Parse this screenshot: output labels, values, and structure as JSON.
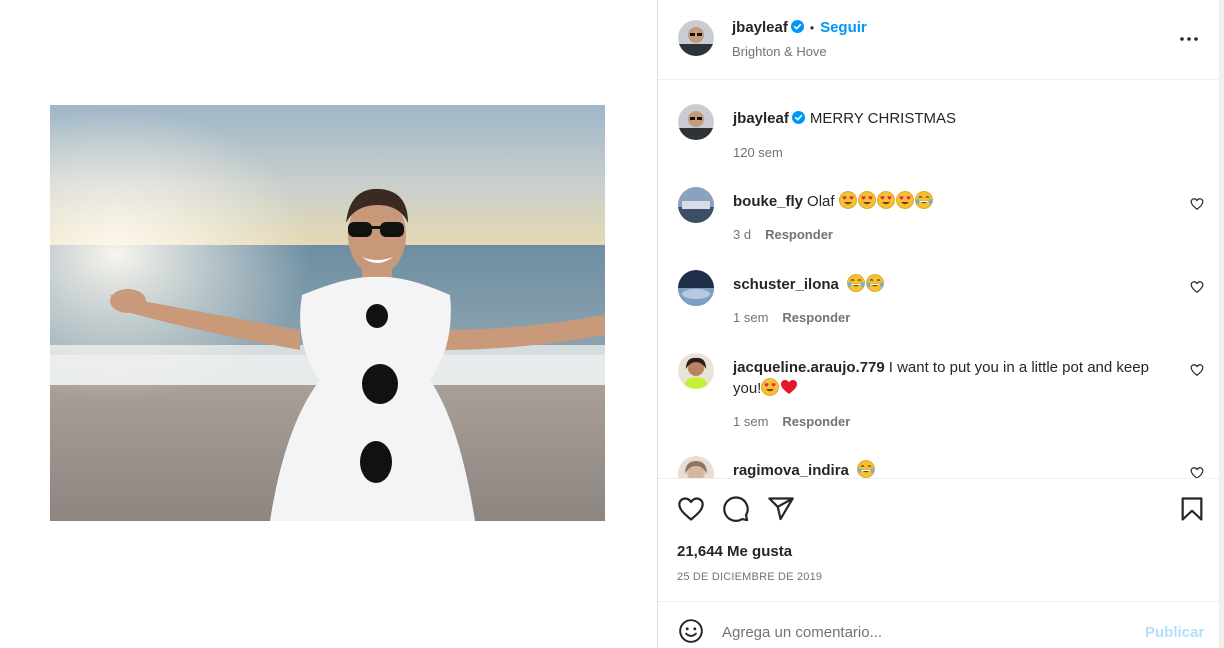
{
  "post": {
    "author": "jbayleaf",
    "follow_label": "Seguir",
    "location": "Brighton & Hove",
    "caption": "MERRY CHRISTMAS",
    "caption_time": "120 sem",
    "likes": "21,644 Me gusta",
    "date": "25 DE DICIEMBRE DE 2019"
  },
  "comments": [
    {
      "user": "bouke_fly",
      "text": "Olaf",
      "emojis": [
        "heart-eyes",
        "heart-eyes",
        "heart-eyes",
        "heart-eyes",
        "tears-of-joy"
      ],
      "time": "3 d",
      "reply": "Responder"
    },
    {
      "user": "schuster_ilona",
      "text": "",
      "emojis": [
        "tears-of-joy",
        "tears-of-joy"
      ],
      "time": "1 sem",
      "reply": "Responder"
    },
    {
      "user": "jacqueline.araujo.779",
      "text": "I want to put you in a little pot and keep you!",
      "emojis": [
        "heart-eyes",
        "red-heart"
      ],
      "time": "1 sem",
      "reply": "Responder"
    },
    {
      "user": "ragimova_indira",
      "text": "",
      "emojis": [
        "tears-of-joy"
      ],
      "time": "",
      "reply": ""
    }
  ],
  "composer": {
    "placeholder": "Agrega un comentario...",
    "publish_label": "Publicar"
  },
  "icons": {
    "verified": "verified-badge-icon",
    "more": "more-options-icon",
    "like": "heart-icon",
    "comment": "comment-bubble-icon",
    "share": "paper-plane-icon",
    "save": "bookmark-icon",
    "emoji": "smiley-icon"
  },
  "colors": {
    "link_blue": "#0095f6",
    "publish_disabled": "#b2dffc",
    "verified_blue": "#0095f6",
    "secondary_text": "#737373",
    "border": "#dbdbdb"
  }
}
